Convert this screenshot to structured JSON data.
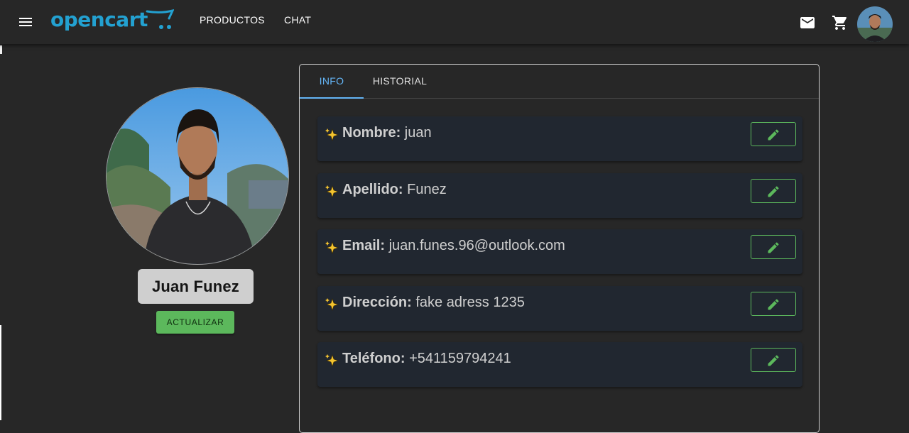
{
  "header": {
    "logo_text": "opencart",
    "nav": [
      {
        "label": "PRODUCTOS"
      },
      {
        "label": "CHAT"
      }
    ],
    "icons": [
      "menu-icon",
      "mail-icon",
      "cart-icon",
      "avatar"
    ]
  },
  "profile": {
    "name": "Juan Funez",
    "update_label": "ACTUALIZAR"
  },
  "tabs": [
    {
      "label": "INFO",
      "active": true
    },
    {
      "label": "HISTORIAL",
      "active": false
    }
  ],
  "fields": [
    {
      "label": "Nombre:",
      "value": "juan"
    },
    {
      "label": "Apellido:",
      "value": "Funez"
    },
    {
      "label": "Email:",
      "value": "juan.funes.96@outlook.com"
    },
    {
      "label": "Dirección:",
      "value": "fake adress 1235"
    },
    {
      "label": "Teléfono:",
      "value": "+541159794241"
    }
  ],
  "colors": {
    "background": "#272727",
    "accent_blue": "#64b5f6",
    "logo_blue": "#23a1d1",
    "success_green": "#5cb85c",
    "row_background": "#212730"
  }
}
